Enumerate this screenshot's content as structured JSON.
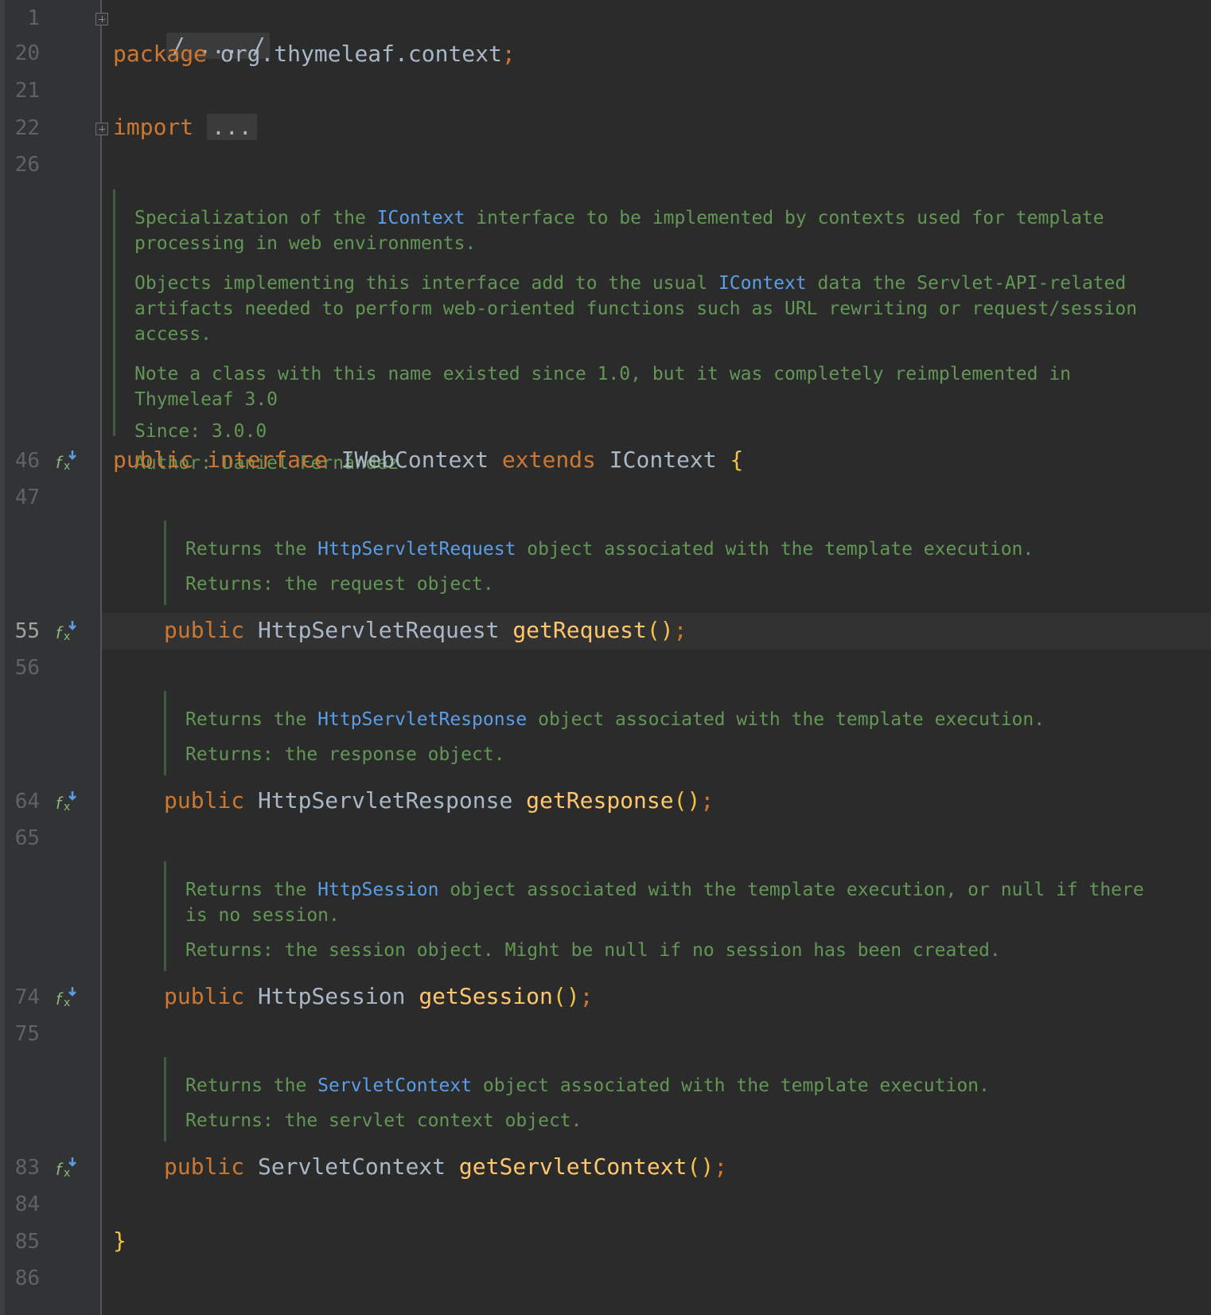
{
  "gutter": {
    "line_numbers": [
      "1",
      "20",
      "21",
      "22",
      "26",
      "46",
      "47",
      "55",
      "56",
      "64",
      "65",
      "74",
      "75",
      "83",
      "84",
      "85",
      "86"
    ],
    "active_line": "55",
    "impl_icon_name": "implements-method-icon"
  },
  "code": {
    "line1_fold_text": "/ ... /",
    "line20_keyword": "package",
    "line20_name": "org.thymeleaf.context",
    "line20_semicolon": ";",
    "line22_keyword": "import",
    "line22_folded": "...",
    "line46_public": "public",
    "line46_interface": "interface",
    "line46_name": "IWebContext",
    "line46_extends": "extends",
    "line46_parent": "IContext",
    "line46_brace": "{",
    "line55_public": "public",
    "line55_type": "HttpServletRequest",
    "line55_method": "getRequest",
    "line55_parens": "()",
    "line55_semicolon": ";",
    "line64_public": "public",
    "line64_type": "HttpServletResponse",
    "line64_method": "getResponse",
    "line64_parens": "()",
    "line64_semicolon": ";",
    "line74_public": "public",
    "line74_type": "HttpSession",
    "line74_method": "getSession",
    "line74_parens": "()",
    "line74_semicolon": ";",
    "line83_public": "public",
    "line83_type": "ServletContext",
    "line83_method": "getServletContext",
    "line83_parens": "()",
    "line83_semicolon": ";",
    "line85_brace": "}"
  },
  "docs": {
    "class_doc": {
      "p1_a": "Specialization of the ",
      "p1_ref": "IContext",
      "p1_b": " interface to be implemented by contexts used for template processing in web environments.",
      "p2_a": "Objects implementing this interface add to the usual ",
      "p2_ref": "IContext",
      "p2_b": " data the Servlet-API-related artifacts needed to perform web-oriented functions such as URL rewriting or request/session access.",
      "p3": "Note a class with this name existed since 1.0, but it was completely reimplemented in Thymeleaf 3.0",
      "since": "Since:  3.0.0",
      "author": "Author: Daniel Fernández"
    },
    "get_request_doc": {
      "a": "Returns the ",
      "ref": "HttpServletRequest",
      "b": " object associated with the template execution.",
      "returns": "Returns: the request object."
    },
    "get_response_doc": {
      "a": "Returns the ",
      "ref": "HttpServletResponse",
      "b": " object associated with the template execution.",
      "returns": "Returns: the response object."
    },
    "get_session_doc": {
      "a": "Returns the ",
      "ref": "HttpSession",
      "b": " object associated with the template execution, or null if there is no session.",
      "returns": "Returns: the session object. Might be null if no session has been created."
    },
    "get_servlet_context_doc": {
      "a": "Returns the ",
      "ref": "ServletContext",
      "b": " object associated with the template execution.",
      "returns": "Returns: the servlet context object."
    }
  },
  "colors": {
    "background": "#2b2b2b",
    "gutter": "#313335",
    "keyword": "#cc7832",
    "method": "#ffc66d",
    "identifier": "#a9b7c6",
    "doc_comment": "#629755",
    "doc_link": "#5a9ee8",
    "line_number": "#606366"
  }
}
